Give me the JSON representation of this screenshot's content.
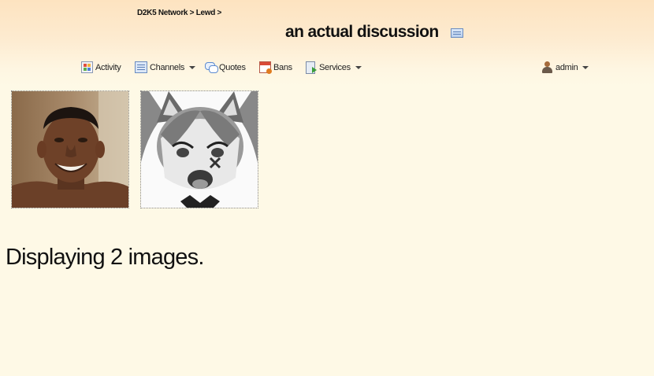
{
  "breadcrumb": {
    "network": "D2K5 Network",
    "sep1": " > ",
    "channel": "Lewd",
    "sep2": " >"
  },
  "page": {
    "title": "an actual discussion"
  },
  "icons": {
    "title": "list-view-icon",
    "activity": "activity-icon",
    "channels": "channels-icon",
    "quotes": "quotes-icon",
    "bans": "bans-icon",
    "services": "services-icon",
    "user": "user-icon"
  },
  "nav": {
    "activity": "Activity",
    "channels": "Channels",
    "quotes": "Quotes",
    "bans": "Bans",
    "services": "Services",
    "user": "admin"
  },
  "colors": {
    "background": "#fef9e6",
    "header_top": "#fde3c0"
  },
  "images": {
    "count_text": "Displaying 2 images."
  }
}
